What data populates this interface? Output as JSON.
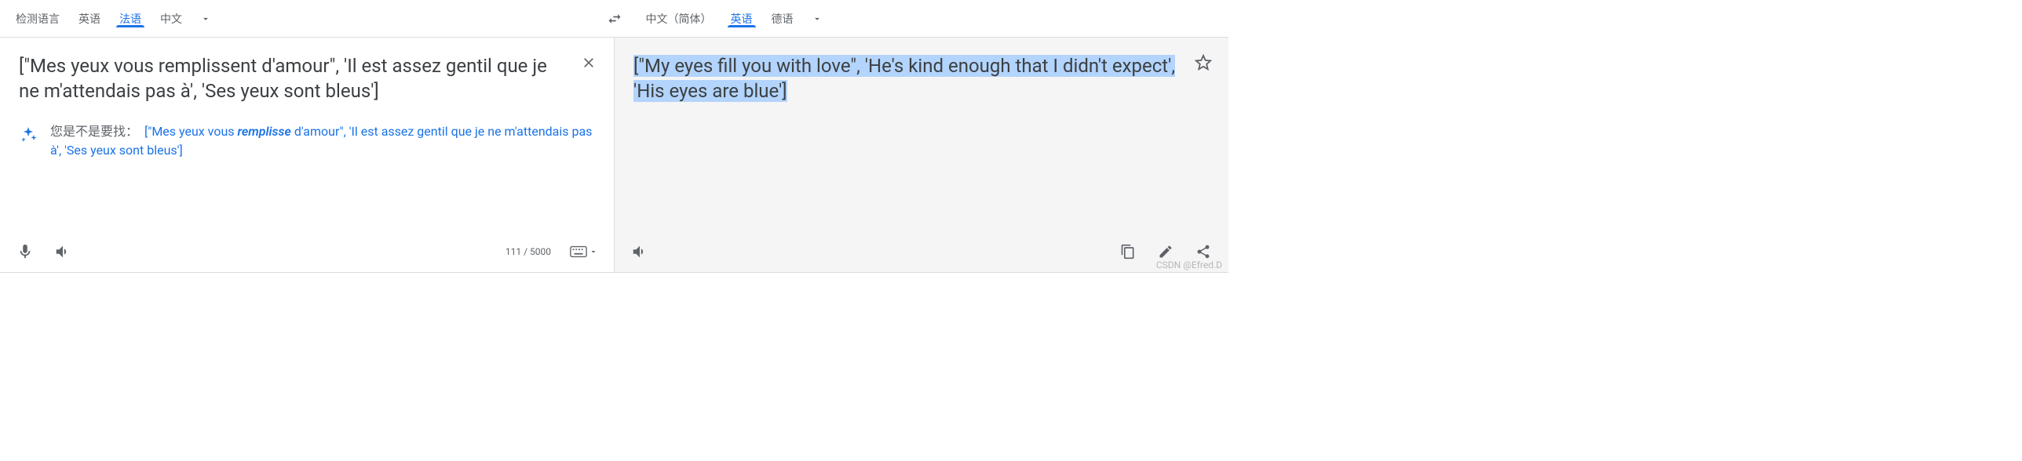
{
  "source_tabs": {
    "items": [
      {
        "label": "检测语言",
        "active": false
      },
      {
        "label": "英语",
        "active": false
      },
      {
        "label": "法语",
        "active": true
      },
      {
        "label": "中文",
        "active": false
      }
    ]
  },
  "target_tabs": {
    "items": [
      {
        "label": "中文（简体）",
        "active": false
      },
      {
        "label": "英语",
        "active": true
      },
      {
        "label": "德语",
        "active": false
      }
    ]
  },
  "source_text": "[\"Mes yeux vous remplissent d'amour\", 'Il est assez gentil que je ne m'attendais pas à', 'Ses yeux sont bleus']",
  "target_text": "[\"My eyes fill you with love\", 'He's kind enough that I didn't expect', 'His eyes are blue']",
  "suggestion": {
    "label": "您是不是要找：",
    "prefix": "[\"Mes yeux vous ",
    "emph": "remplisse",
    "suffix": " d'amour\", 'Il est assez gentil que je ne m'attendais pas à', 'Ses yeux sont bleus']"
  },
  "char_count": "111 / 5000",
  "watermark": "CSDN @Efred.D"
}
